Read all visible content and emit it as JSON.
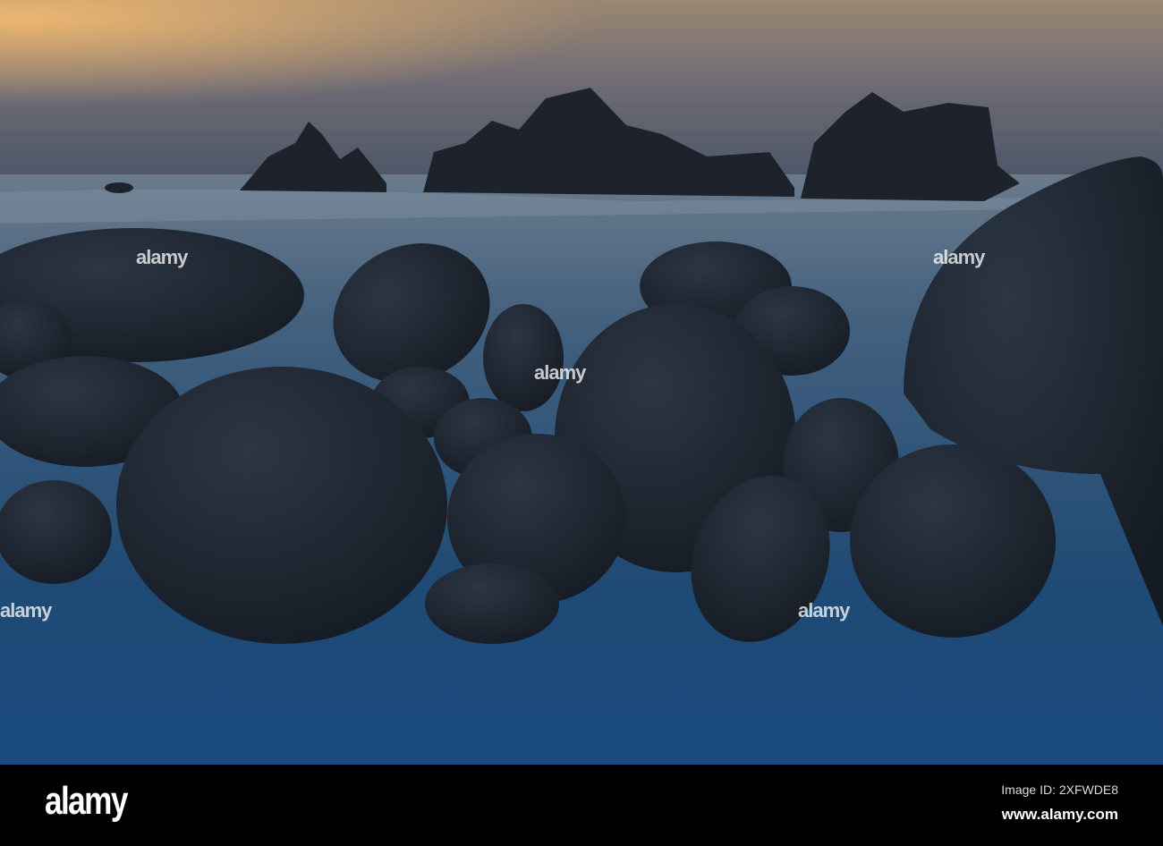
{
  "watermark": {
    "text": "alamy"
  },
  "footer": {
    "logo": "alamy",
    "image_id": "Image ID: 2XFWDE8",
    "url": "www.alamy.com"
  }
}
